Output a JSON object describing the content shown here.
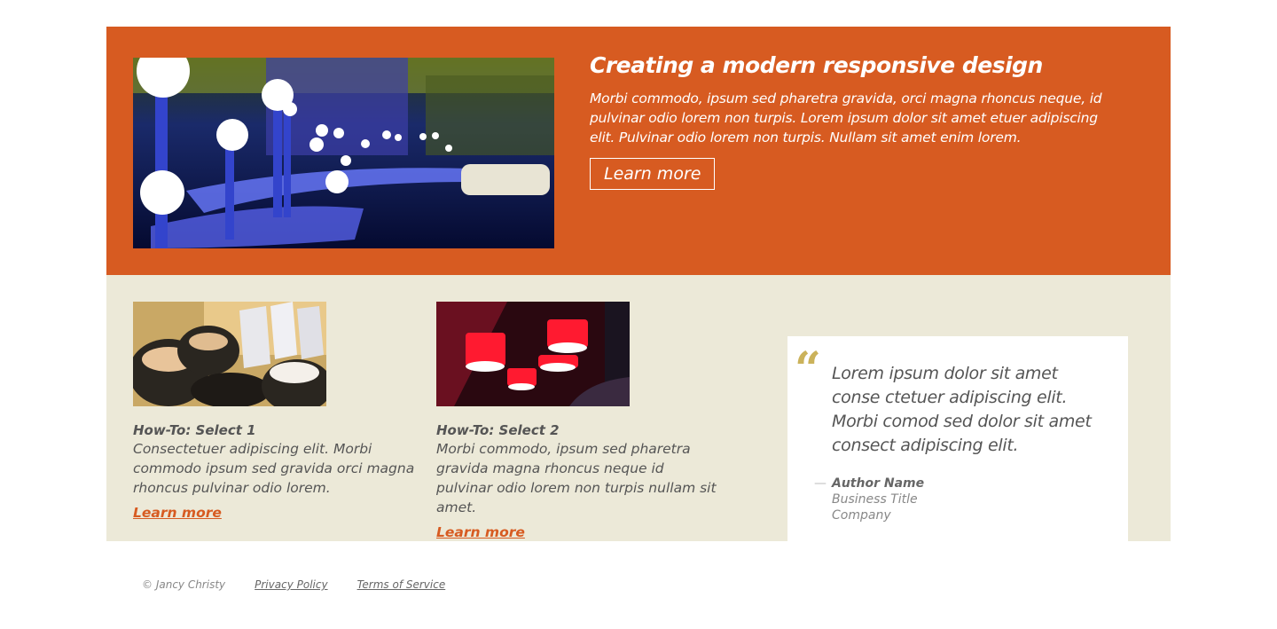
{
  "hero": {
    "title": "Creating a modern responsive design",
    "description": "Morbi commodo, ipsum sed pharetra gravida, orci magna rhoncus neque, id pulvinar odio lorem non turpis. Lorem ipsum dolor sit amet etuer adipiscing elit. Pulvinar odio lorem non turpis. Nullam sit amet enim lorem.",
    "button_label": "Learn more"
  },
  "cards": [
    {
      "title": "How-To: Select 1",
      "text": "Consectetuer adipiscing elit. Morbi commodo ipsum sed gravida orci magna rhoncus pulvinar odio lorem.",
      "link": "Learn more"
    },
    {
      "title": "How-To: Select 2",
      "text": "Morbi commodo, ipsum sed pharetra gravida magna rhoncus neque id pulvinar odio lorem non turpis nullam sit amet.",
      "link": "Learn more"
    }
  ],
  "quote": {
    "mark": "“",
    "text": "Lorem ipsum dolor sit amet conse ctetuer adipiscing elit. Morbi comod sed dolor sit amet consect adipiscing elit.",
    "dash": "—",
    "author_name": "Author Name",
    "author_title": "Business Title",
    "author_company": "Company"
  },
  "footer": {
    "copyright": "© Jancy Christy",
    "privacy": "Privacy Policy",
    "terms": "Terms of Service"
  },
  "colors": {
    "accent": "#d75b21",
    "band": "#ece9d8",
    "quote_mark": "#cbb25a"
  }
}
